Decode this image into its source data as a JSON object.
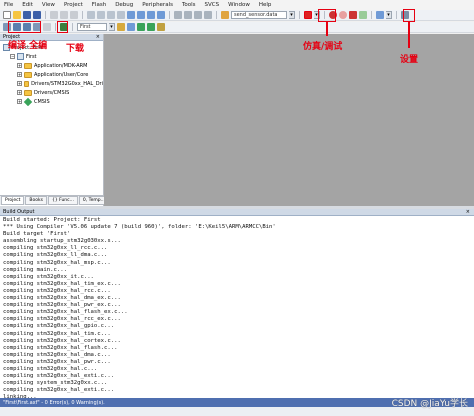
{
  "menu": [
    "File",
    "Edit",
    "View",
    "Project",
    "Flash",
    "Debug",
    "Peripherals",
    "Tools",
    "SVCS",
    "Window",
    "Help"
  ],
  "toolbar": {
    "file_combo": "send_sensor.data",
    "target_combo": "First"
  },
  "project_panel": {
    "title": "Project",
    "close": "×",
    "tree": [
      {
        "label": "Project: First",
        "level": 0,
        "icon": "root-icon"
      },
      {
        "label": "First",
        "level": 1,
        "icon": "target-icon"
      },
      {
        "label": "Application/MDK-ARM",
        "level": 2,
        "icon": "folder-icon"
      },
      {
        "label": "Application/User/Core",
        "level": 2,
        "icon": "folder-icon"
      },
      {
        "label": "Drivers/STM32G0xx_HAL_Dri",
        "level": 2,
        "icon": "folder-icon"
      },
      {
        "label": "Drivers/CMSIS",
        "level": 2,
        "icon": "folder-icon"
      },
      {
        "label": "CMSIS",
        "level": 2,
        "icon": "gem-icon"
      }
    ],
    "tabs": [
      "Project",
      "Books",
      "{} Func...",
      "0, Temp..."
    ]
  },
  "build_output": {
    "title": "Build Output",
    "close": "×",
    "lines": [
      "Build started: Project: First",
      "*** Using Compiler 'V5.06 update 7 (build 960)', folder: 'E:\\Keil5\\ARM\\ARMCC\\Bin'",
      "Build target 'First'",
      "assembling startup_stm32g030xx.s...",
      "compiling stm32g0xx_ll_rcc.c...",
      "compiling stm32g0xx_ll_dma.c...",
      "compiling stm32g0xx_hal_msp.c...",
      "compiling main.c...",
      "compiling stm32g0xx_it.c...",
      "compiling stm32g0xx_hal_tim_ex.c...",
      "compiling stm32g0xx_hal_rcc.c...",
      "compiling stm32g0xx_hal_dma_ex.c...",
      "compiling stm32g0xx_hal_pwr_ex.c...",
      "compiling stm32g0xx_hal_flash_ex.c...",
      "compiling stm32g0xx_hal_rcc_ex.c...",
      "compiling stm32g0xx_hal_gpio.c...",
      "compiling stm32g0xx_hal_tim.c...",
      "compiling stm32g0xx_hal_cortex.c...",
      "compiling stm32g0xx_hal_flash.c...",
      "compiling stm32g0xx_hal_dma.c...",
      "compiling stm32g0xx_hal_pwr.c...",
      "compiling stm32g0xx_hal.c...",
      "compiling stm32g0xx_hal_exti.c...",
      "compiling system_stm32g0xx.c...",
      "compiling stm32g0xx_hal_exti.c...",
      "linking...",
      "Program Size: Code=2192 RO-data=288 RW-data=16 ZI-data=1024",
      "FromELF: creating hex file...",
      "\"First\\First.axf\" - 0 Error(s), 0 Warning(s).",
      "Build Time Elapsed:  00:00:02"
    ]
  },
  "bottom_tabs": [
    "\"First\\First.axf\" - 0 Error(s), 0 Warning(s)."
  ],
  "annotations": {
    "build_label": "编译 全编",
    "download_label": "下载",
    "debug_label": "仿真/调试",
    "settings_label": "设置"
  },
  "watermark": "CSDN @JiaYu学长",
  "colors": {
    "annotation": "#e60012",
    "editor_bg": "#a4a4a4",
    "bottom_bar": "#4f6fb0"
  }
}
